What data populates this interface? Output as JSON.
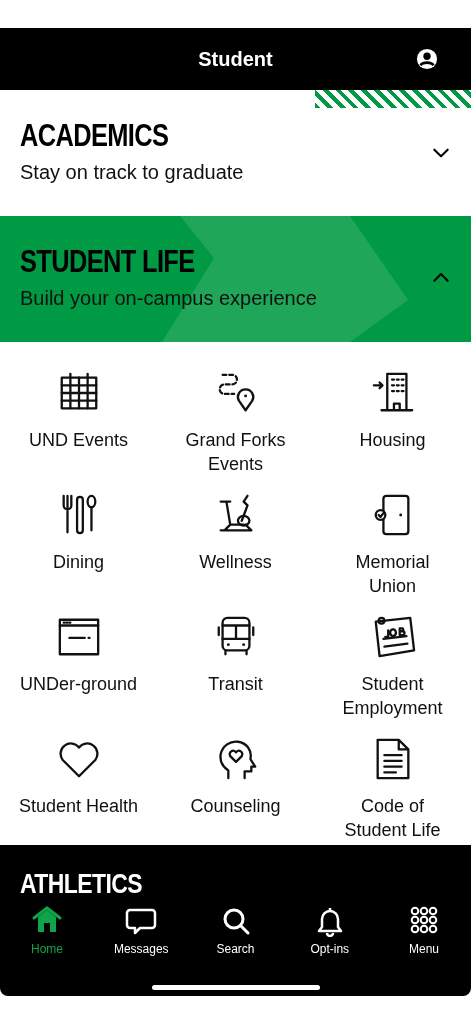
{
  "header": {
    "title": "Student"
  },
  "sections": [
    {
      "title": "ACADEMICS",
      "subtitle": "Stay on track to graduate",
      "expanded": false
    },
    {
      "title": "STUDENT LIFE",
      "subtitle": "Build your on-campus experience",
      "expanded": true
    }
  ],
  "tiles": [
    {
      "label": "UND Events"
    },
    {
      "label": "Grand Forks Events"
    },
    {
      "label": "Housing"
    },
    {
      "label": "Dining"
    },
    {
      "label": "Wellness"
    },
    {
      "label": "Memorial Union"
    },
    {
      "label": "UNDer-ground"
    },
    {
      "label": "Transit"
    },
    {
      "label": "Student Employment"
    },
    {
      "label": "Student Health"
    },
    {
      "label": "Counseling"
    },
    {
      "label": "Code of Student Life"
    }
  ],
  "next_section": {
    "title": "ATHLETICS"
  },
  "tab_bar": [
    {
      "label": "Home",
      "selected": true
    },
    {
      "label": "Messages",
      "selected": false
    },
    {
      "label": "Search",
      "selected": false
    },
    {
      "label": "Opt-ins",
      "selected": false
    },
    {
      "label": "Menu",
      "selected": false
    }
  ]
}
